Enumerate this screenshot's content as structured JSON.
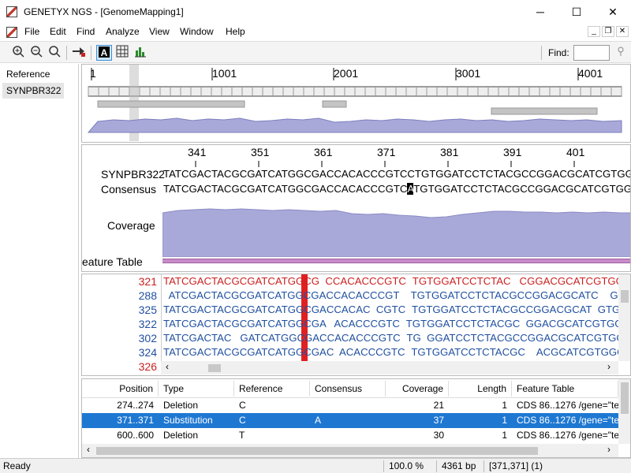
{
  "window": {
    "title": "GENETYX NGS - [GenomeMapping1]",
    "minimize": "─",
    "maximize": "☐",
    "close": "✕"
  },
  "menu": [
    "File",
    "Edit",
    "Find",
    "Analyze",
    "View",
    "Window",
    "Help"
  ],
  "mdi": {
    "min": "_",
    "restore": "❐",
    "close": "✕"
  },
  "toolbar": {
    "find_label": "Find:",
    "find_value": ""
  },
  "left_pane": {
    "items": [
      "Reference",
      "SYNPBR322"
    ]
  },
  "overview": {
    "ticks": [
      "1",
      "1001",
      "2001",
      "3001",
      "4001"
    ]
  },
  "detail": {
    "ticks": [
      "341",
      "351",
      "361",
      "371",
      "381",
      "391",
      "401"
    ],
    "ref_label": "SYNPBR322",
    "cons_label": "Consensus",
    "coverage_label": "Coverage",
    "feature_label": "eature Table",
    "ref_seq": "TATCGACTACGCGATCATGGCGACCACACCCGTCCTGTGGATCCTCTACGCCGGACGCATCGTGGCCGGCATCA",
    "cons_pre": "TATCGACTACGCGATCATGGCGACCACACCCGTC",
    "cons_hl": "A",
    "cons_post": "TGTGGATCCTCTACGCCGGACGCATCGTGGCCGGCATCA"
  },
  "reads": [
    {
      "num": "321",
      "color": "#cc2020",
      "pre": "TATCGACTACGCGATCATGGCG  CCACACCCGTC",
      "hl": "A",
      "post": "TGTGGATCCTCTAC   CGGACGCATCGTGGCCGGCAT"
    },
    {
      "num": "288",
      "color": "#2050a0",
      "pre": "  ATCGACTACGCGATCATGGCGACCACACCCGT  ",
      "hl": "A",
      "post": "TGTGGATCCTCTACGCCGGACGCATC    GGCCGGCAT"
    },
    {
      "num": "325",
      "color": "#2050a0",
      "pre": "TATCGACTACGCGATCATGGCGACCACAC  CGTC",
      "hl": "A",
      "post": "TGTGGATCCTCTACGCCGGACGCAT  GTGGCCGGCAT"
    },
    {
      "num": "322",
      "color": "#2050a0",
      "pre": "TATCGACTACGCGATCATGGCGA   ACACCCGTC",
      "hl": "A",
      "post": "TGTGGATCCTCTACGC  GGACGCATCGTGGCCGGCAT"
    },
    {
      "num": "302",
      "color": "#2050a0",
      "pre": "TATCGACTAC   GATCATGGCGACCACACCCGTC",
      "hl": "A",
      "post": "TG  GGATCCTCTACGCCGGACGCATCGTGGC  GGCAT"
    },
    {
      "num": "324",
      "color": "#2050a0",
      "pre": "TATCGACTACGCGATCATGGCGAC  ACACCCGTC",
      "hl": "A",
      "post": "TGTGGATCCTCTACGC    ACGCATCGTGGCCGGCAT"
    },
    {
      "num": "326",
      "color": "#cc2020",
      "pre": "",
      "hl": "",
      "post": ""
    }
  ],
  "table": {
    "columns": [
      "Position",
      "Type",
      "Reference",
      "Consensus",
      "Coverage",
      "Length",
      "Feature Table"
    ],
    "rows": [
      {
        "position": "274..274",
        "type": "Deletion",
        "reference": "C",
        "consensus": "",
        "coverage": "21",
        "length": "1",
        "feature": "CDS 86..1276 /gene=\"tet"
      },
      {
        "position": "371..371",
        "type": "Substitution",
        "reference": "C",
        "consensus": "A",
        "coverage": "37",
        "length": "1",
        "feature": "CDS 86..1276 /gene=\"tet",
        "selected": true
      },
      {
        "position": "600..600",
        "type": "Deletion",
        "reference": "T",
        "consensus": "",
        "coverage": "30",
        "length": "1",
        "feature": "CDS 86..1276 /gene=\"tet"
      }
    ]
  },
  "status": {
    "left": "Ready",
    "zoom": "100.0 %",
    "size": "4361 bp",
    "cursor": "[371,371] (1)"
  },
  "colors": {
    "selection": "#1e78d2",
    "coverage_fill": "#a9a9d9",
    "accent_red": "#e02020",
    "feature_band": "#c88cc8"
  }
}
